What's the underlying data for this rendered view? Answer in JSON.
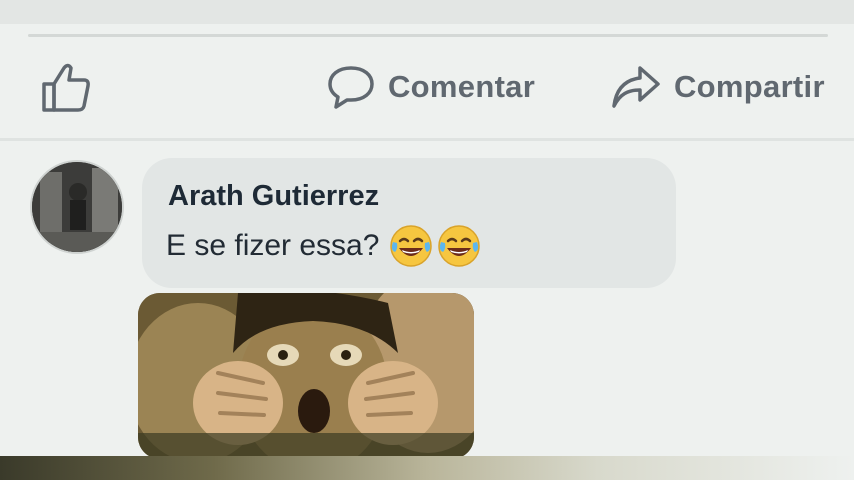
{
  "actions": {
    "like": {
      "label": ""
    },
    "comment": {
      "label": "Comentar"
    },
    "share": {
      "label": "Compartir"
    }
  },
  "comment": {
    "author": "Arath Gutierrez",
    "text": "E se fizer essa?",
    "emojis": [
      "tears-of-joy-emoji",
      "tears-of-joy-emoji"
    ]
  },
  "icons": {
    "like": "thumbs-up-icon",
    "comment": "speech-bubble-icon",
    "share": "share-arrow-icon"
  },
  "colors": {
    "action_gray": "#606870",
    "author_text": "#1e2a36",
    "bubble_bg": "#e2e6e5"
  }
}
